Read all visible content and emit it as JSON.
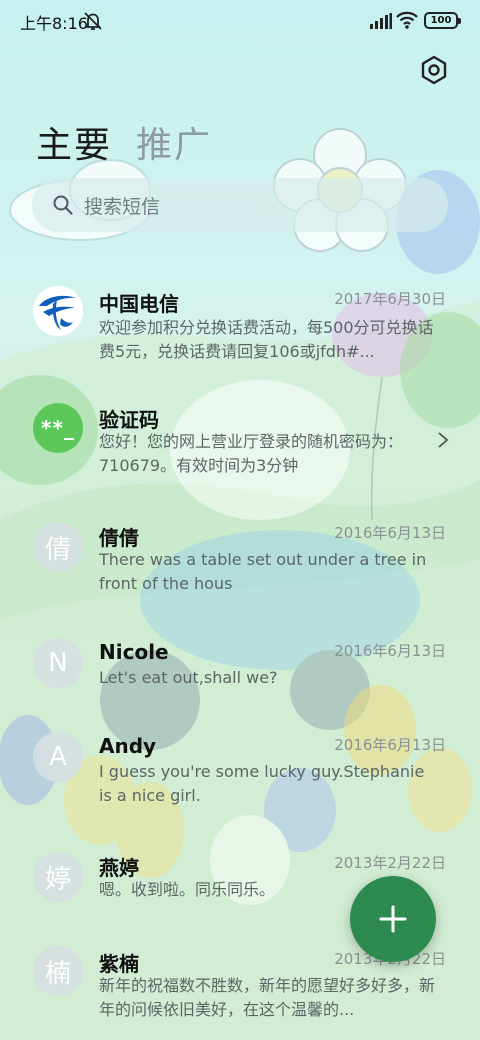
{
  "status_bar": {
    "time": "上午8:16",
    "battery": "100",
    "icons": [
      "mute-icon",
      "signal-icon",
      "wifi-icon",
      "battery-icon"
    ]
  },
  "header": {
    "settings_icon": "settings-hexagon-icon",
    "tabs": [
      {
        "label": "主要",
        "active": true
      },
      {
        "label": "推广",
        "active": false
      }
    ]
  },
  "search": {
    "placeholder": "搜索短信",
    "icon": "search-icon"
  },
  "conversations": [
    {
      "name": "中国电信",
      "date": "2017年6月30日",
      "preview": "欢迎参加积分兑换话费活动，每500分可兑换话费5元，兑换话费请回复106或jfdh#...",
      "avatar_type": "logo",
      "avatar_icon": "china-telecom-logo-icon"
    },
    {
      "name": "验证码",
      "date": "",
      "preview": "您好！您的网上营业厅登录的随机密码为：710679。有效时间为3分钟",
      "avatar_type": "code",
      "avatar_text": "**_",
      "has_chevron": true
    },
    {
      "name": "倩倩",
      "date": "2016年6月13日",
      "preview": "There was a table set out under a tree in front of the hous",
      "avatar_text": "倩"
    },
    {
      "name": "Nicole",
      "date": "2016年6月13日",
      "preview": "Let's eat out,shall we?",
      "avatar_text": "N"
    },
    {
      "name": "Andy",
      "date": "2016年6月13日",
      "preview": "I guess you're some lucky guy.Stephanie is a nice girl.",
      "avatar_text": "A"
    },
    {
      "name": "燕婷",
      "date": "2013年2月22日",
      "preview": "嗯。收到啦。同乐同乐。",
      "avatar_text": "婷"
    },
    {
      "name": "紫楠",
      "date": "2013年2月22日",
      "preview": "新年的祝福数不胜数，新年的愿望好多好多，新年的问候依旧美好，在这个温馨的...",
      "avatar_text": "楠"
    }
  ],
  "fab": {
    "icon": "plus-icon",
    "color": "#2e8b4f"
  },
  "colors": {
    "accent": "#2e8b4f",
    "verification_avatar": "#5dc85a",
    "telecom_blue": "#0f5fbf"
  }
}
